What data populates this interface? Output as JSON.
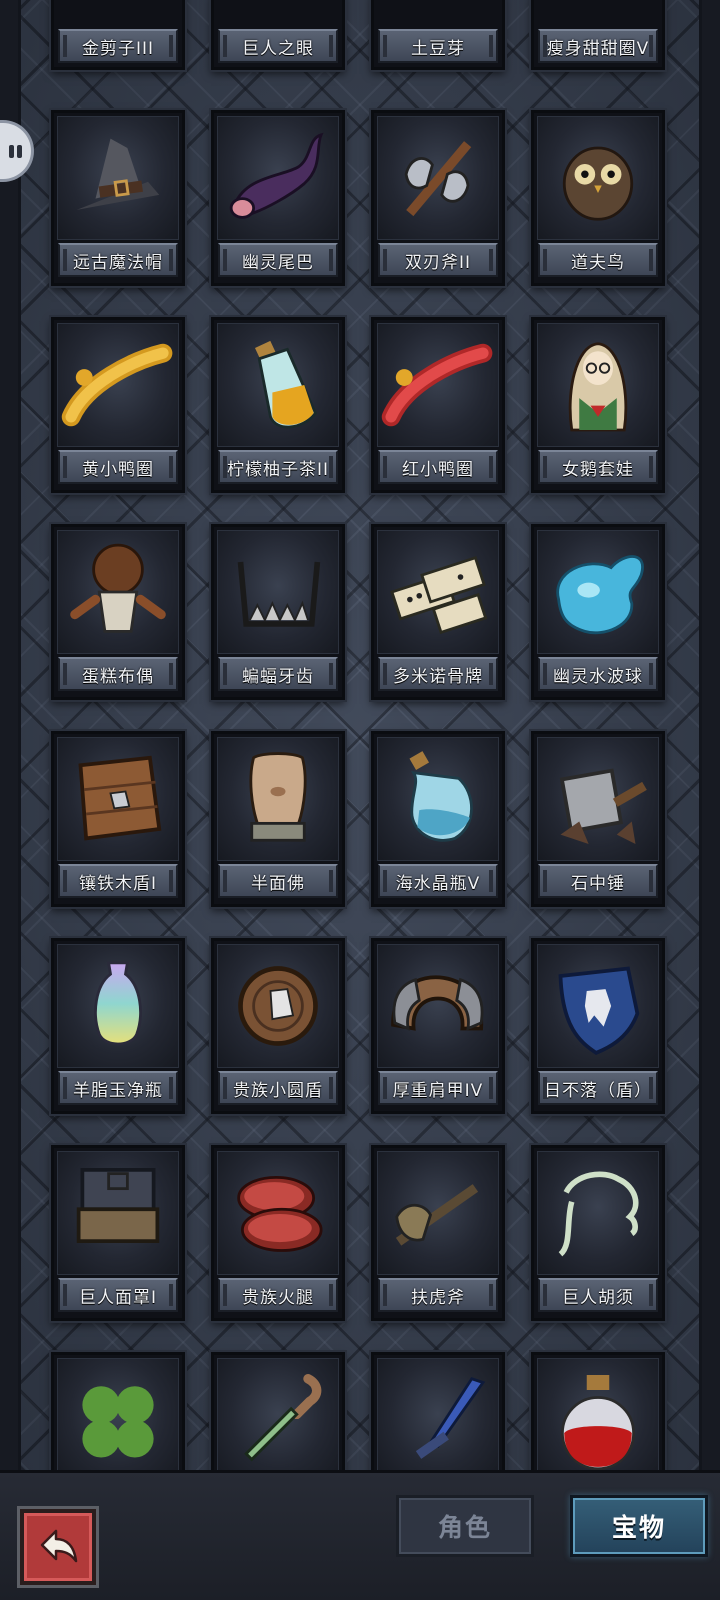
{
  "inventory": {
    "rows": [
      {
        "items": [
          {
            "name": "金剪子III",
            "icon": "scissors-icon"
          },
          {
            "name": "巨人之眼",
            "icon": "eye-icon"
          },
          {
            "name": "土豆芽",
            "icon": "potato-icon"
          },
          {
            "name": "瘦身甜甜圈V",
            "icon": "donut-icon"
          }
        ]
      },
      {
        "items": [
          {
            "name": "远古魔法帽",
            "icon": "wizard-hat-icon"
          },
          {
            "name": "幽灵尾巴",
            "icon": "ghost-tail-icon"
          },
          {
            "name": "双刃斧II",
            "icon": "double-axe-icon"
          },
          {
            "name": "道夫鸟",
            "icon": "owl-icon"
          }
        ]
      },
      {
        "items": [
          {
            "name": "黄小鸭圈",
            "icon": "yellow-duck-ring-icon"
          },
          {
            "name": "柠檬柚子茶II",
            "icon": "tea-potion-icon"
          },
          {
            "name": "红小鸭圈",
            "icon": "red-duck-ring-icon"
          },
          {
            "name": "女鹅套娃",
            "icon": "matryoshka-icon"
          }
        ]
      },
      {
        "items": [
          {
            "name": "蛋糕布偶",
            "icon": "voodoo-doll-icon"
          },
          {
            "name": "蝙蝠牙齿",
            "icon": "bat-teeth-icon"
          },
          {
            "name": "多米诺骨牌",
            "icon": "domino-icon"
          },
          {
            "name": "幽灵水波球",
            "icon": "water-ball-icon"
          }
        ]
      },
      {
        "items": [
          {
            "name": "镶铁木盾I",
            "icon": "wood-shield-icon"
          },
          {
            "name": "半面佛",
            "icon": "half-buddha-icon"
          },
          {
            "name": "海水晶瓶V",
            "icon": "sea-bottle-icon"
          },
          {
            "name": "石中锤",
            "icon": "stone-hammer-icon"
          }
        ]
      },
      {
        "items": [
          {
            "name": "羊脂玉净瓶",
            "icon": "jade-vase-icon"
          },
          {
            "name": "贵族小圆盾",
            "icon": "round-shield-icon"
          },
          {
            "name": "厚重肩甲IV",
            "icon": "shoulder-armor-icon"
          },
          {
            "name": "日不落（盾）",
            "icon": "crest-shield-icon"
          }
        ]
      },
      {
        "items": [
          {
            "name": "巨人面罩I",
            "icon": "giant-mask-icon"
          },
          {
            "name": "贵族火腿",
            "icon": "ham-icon"
          },
          {
            "name": "扶虎斧",
            "icon": "tiger-axe-icon"
          },
          {
            "name": "巨人胡须",
            "icon": "beard-icon"
          }
        ]
      },
      {
        "items": [
          {
            "name": "",
            "icon": "clover-icon"
          },
          {
            "name": "",
            "icon": "dagger-icon"
          },
          {
            "name": "",
            "icon": "sword-icon"
          },
          {
            "name": "",
            "icon": "red-potion-icon"
          }
        ]
      }
    ]
  },
  "bottom_bar": {
    "back_icon": "back-arrow-icon",
    "tab_role": "角色",
    "tab_treasure": "宝物",
    "active_tab": "宝物"
  },
  "colors": {
    "panel": "#3a4354",
    "card_label": "#4e5667",
    "active_tab": "#2c5670",
    "back_button": "#b13a3a"
  }
}
